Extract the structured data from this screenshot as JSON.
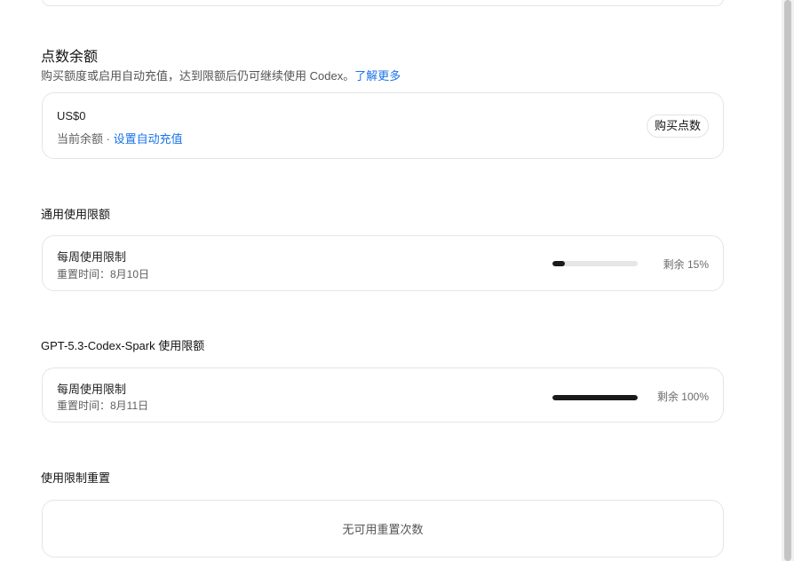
{
  "credits": {
    "title": "点数余额",
    "description": "购买额度或启用自动充值，达到限额后仍可继续使用 Codex。",
    "learn_more": "了解更多",
    "amount": "US$0",
    "balance_label": "当前余额 · ",
    "auto_recharge_link": "设置自动充值",
    "buy_button": "购买点数"
  },
  "general_limits": {
    "heading": "通用使用限额",
    "item_title": "每周使用限制",
    "reset_text": "重置时间：8月10日",
    "remaining_fraction": 0.15,
    "remaining_text": "剩余 15%"
  },
  "spark_limits": {
    "heading": "GPT-5.3-Codex-Spark 使用限额",
    "item_title": "每周使用限制",
    "reset_text": "重置时间：8月11日",
    "remaining_fraction": 1.0,
    "remaining_text": "剩余 100%"
  },
  "reset": {
    "heading": "使用限制重置",
    "empty_text": "无可用重置次数"
  },
  "colors": {
    "link": "#1a73e8",
    "bar_fill": "#1a1a1a",
    "bar_track": "#e6e6e6"
  }
}
